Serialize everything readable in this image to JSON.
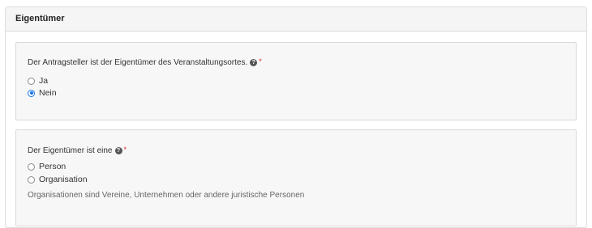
{
  "panel": {
    "title": "Eigentümer"
  },
  "question_1": {
    "label": "Der Antragsteller ist der Eigentümer des Veranstaltungsortes.",
    "help_icon_glyph": "?",
    "required_marker": "*",
    "options": [
      {
        "label": "Ja",
        "selected": false
      },
      {
        "label": "Nein",
        "selected": true
      }
    ]
  },
  "question_2": {
    "label": "Der Eigentümer ist eine",
    "help_icon_glyph": "?",
    "required_marker": "*",
    "options": [
      {
        "label": "Person",
        "selected": false
      },
      {
        "label": "Organisation",
        "selected": false
      }
    ],
    "hint": "Organisationen sind Vereine, Unternehmen oder andere juristische Personen"
  },
  "colors": {
    "accent": "#1a73e8",
    "required": "#e02020",
    "card_background": "#f7f7f7",
    "header_background": "#f5f5f5"
  },
  "icons": {
    "help": "question-circle-icon"
  }
}
